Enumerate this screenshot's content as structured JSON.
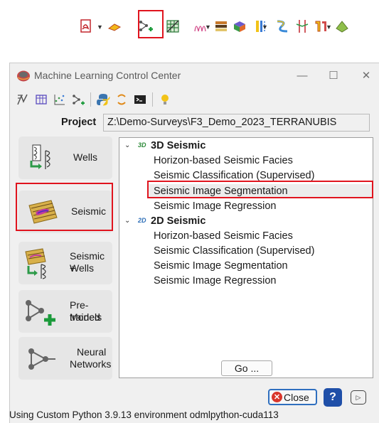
{
  "window": {
    "title": "Machine Learning Control Center",
    "minimize": "—",
    "maximize": "☐",
    "close": "✕"
  },
  "project": {
    "label": "Project",
    "path": "Z:\\Demo-Surveys\\F3_Demo_2023_TERRANUBIS"
  },
  "categories": [
    {
      "label": "Wells",
      "icon": "wells-icon"
    },
    {
      "label": "Seismic",
      "icon": "seismic-icon"
    },
    {
      "label": "Seismic +\nWells",
      "line1": "Seismic +",
      "line2": "Wells",
      "icon": "seismic-wells-icon"
    },
    {
      "label": "Pre-trained Models",
      "line1": "Pre-trained",
      "line2": "Models",
      "icon": "pretrained-models-icon"
    },
    {
      "label": "Neural Networks",
      "line1": "Neural",
      "line2": "Networks",
      "icon": "neural-networks-icon"
    }
  ],
  "tree": {
    "section_3d": {
      "badge": "3D",
      "label": "3D Seismic",
      "items": [
        "Horizon-based Seismic Facies",
        "Seismic Classification (Supervised)",
        "Seismic Image Segmentation",
        "Seismic Image Regression"
      ]
    },
    "section_2d": {
      "badge": "2D",
      "label": "2D Seismic",
      "items": [
        "Horizon-based Seismic Facies",
        "Seismic Classification (Supervised)",
        "Seismic Image Segmentation",
        "Seismic Image Regression"
      ]
    }
  },
  "buttons": {
    "go": "Go ...",
    "close": "Close",
    "help": "?",
    "video": "▷"
  },
  "status": "Using Custom Python 3.9.13 environment odmlpython-cuda113",
  "colors": {
    "highlight": "#e0141e",
    "accent_blue": "#1f4fa8",
    "hover_row": "#e5f1fb"
  }
}
